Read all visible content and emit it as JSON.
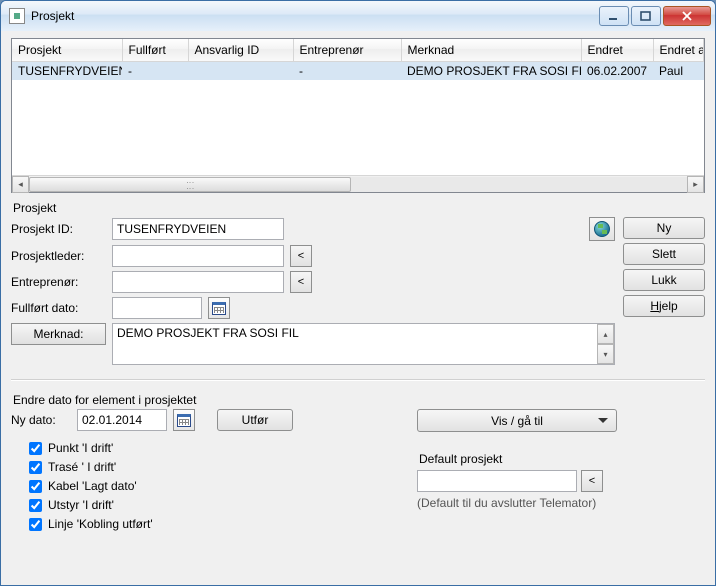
{
  "window": {
    "title": "Prosjekt"
  },
  "table": {
    "headers": [
      "Prosjekt",
      "Fullført",
      "Ansvarlig ID",
      "Entreprenør",
      "Merknad",
      "Endret",
      "Endret a"
    ],
    "rows": [
      {
        "cells": [
          "TUSENFRYDVEIEN",
          "-",
          "",
          "-",
          "DEMO PROSJEKT FRA SOSI FIL",
          "06.02.2007",
          "Paul"
        ],
        "selected": true
      }
    ]
  },
  "form": {
    "legend": "Prosjekt",
    "prosjekt_id_label": "Prosjekt ID:",
    "prosjekt_id_value": "TUSENFRYDVEIEN",
    "prosjektleder_label": "Prosjektleder:",
    "prosjektleder_value": "",
    "entreprenor_label": "Entreprenør:",
    "entreprenor_value": "",
    "fullfort_label": "Fullført dato:",
    "fullfort_value": "",
    "merknad_button": "Merknad:",
    "merknad_text": "DEMO PROSJEKT FRA SOSI FIL"
  },
  "buttons": {
    "ny": "Ny",
    "slett": "Slett",
    "lukk": "Lukk",
    "hjelp": "Hjelp"
  },
  "lower": {
    "legend": "Endre dato for element i prosjektet",
    "nydato_label": "Ny dato:",
    "nydato_value": "02.01.2014",
    "utfor": "Utfør",
    "dropdown": "Vis / gå til",
    "checks": [
      "Punkt 'I drift'",
      "Trasé ' I drift'",
      "Kabel 'Lagt dato'",
      "Utstyr 'I drift'",
      "Linje 'Kobling utført'"
    ],
    "default_title": "Default prosjekt",
    "default_value": "",
    "default_hint": "(Default til du avslutter Telemator)"
  }
}
